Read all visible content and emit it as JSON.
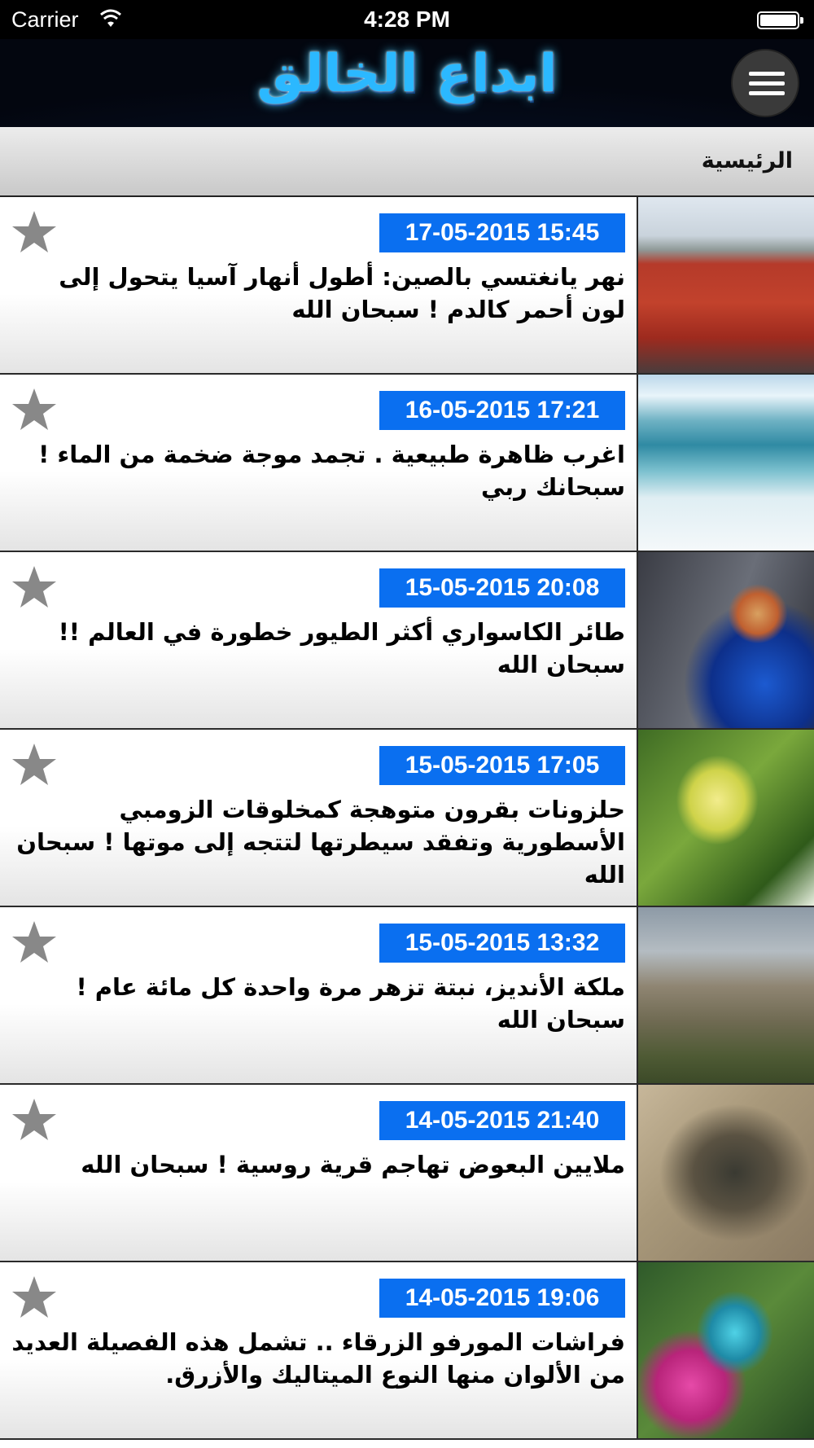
{
  "status_bar": {
    "carrier": "Carrier",
    "time": "4:28 PM"
  },
  "header": {
    "logo_text": "ابداع الخالق",
    "menu_icon": "hamburger-menu-icon"
  },
  "page": {
    "title": "الرئيسية"
  },
  "colors": {
    "date_badge": "#0a6ff0",
    "star": "#888888"
  },
  "articles": [
    {
      "date": "17-05-2015 15:45",
      "title": "نهر يانغتسي بالصين: أطول أنهار آسيا يتحول إلى لون أحمر كالدم ! سبحان الله",
      "thumb": "red-river"
    },
    {
      "date": "16-05-2015 17:21",
      "title": "اغرب ظاهرة طبيعية . تجمد موجة ضخمة من الماء ! سبحانك ربي",
      "thumb": "frozen-wave"
    },
    {
      "date": "15-05-2015 20:08",
      "title": "طائر الكاسواري أكثر الطيور خطورة في العالم !! سبحان الله",
      "thumb": "cassowary"
    },
    {
      "date": "15-05-2015 17:05",
      "title": "حلزونات بقرون متوهجة كمخلوقات الزومبي الأسطورية وتفقد سيطرتها لتتجه إلى موتها ! سبحان الله",
      "thumb": "snail"
    },
    {
      "date": "15-05-2015 13:32",
      "title": "ملكة الأنديز، نبتة تزهر مرة واحدة كل مائة عام ! سبحان الله",
      "thumb": "puya-plant"
    },
    {
      "date": "14-05-2015 21:40",
      "title": "ملايين البعوض تهاجم قرية روسية ! سبحان الله",
      "thumb": "mosquitoes"
    },
    {
      "date": "14-05-2015 19:06",
      "title": "فراشات المورفو الزرقاء .. تشمل هذه الفصيلة العديد من الألوان منها النوع الميتاليك والأزرق.",
      "thumb": "morpho-butterfly"
    }
  ]
}
